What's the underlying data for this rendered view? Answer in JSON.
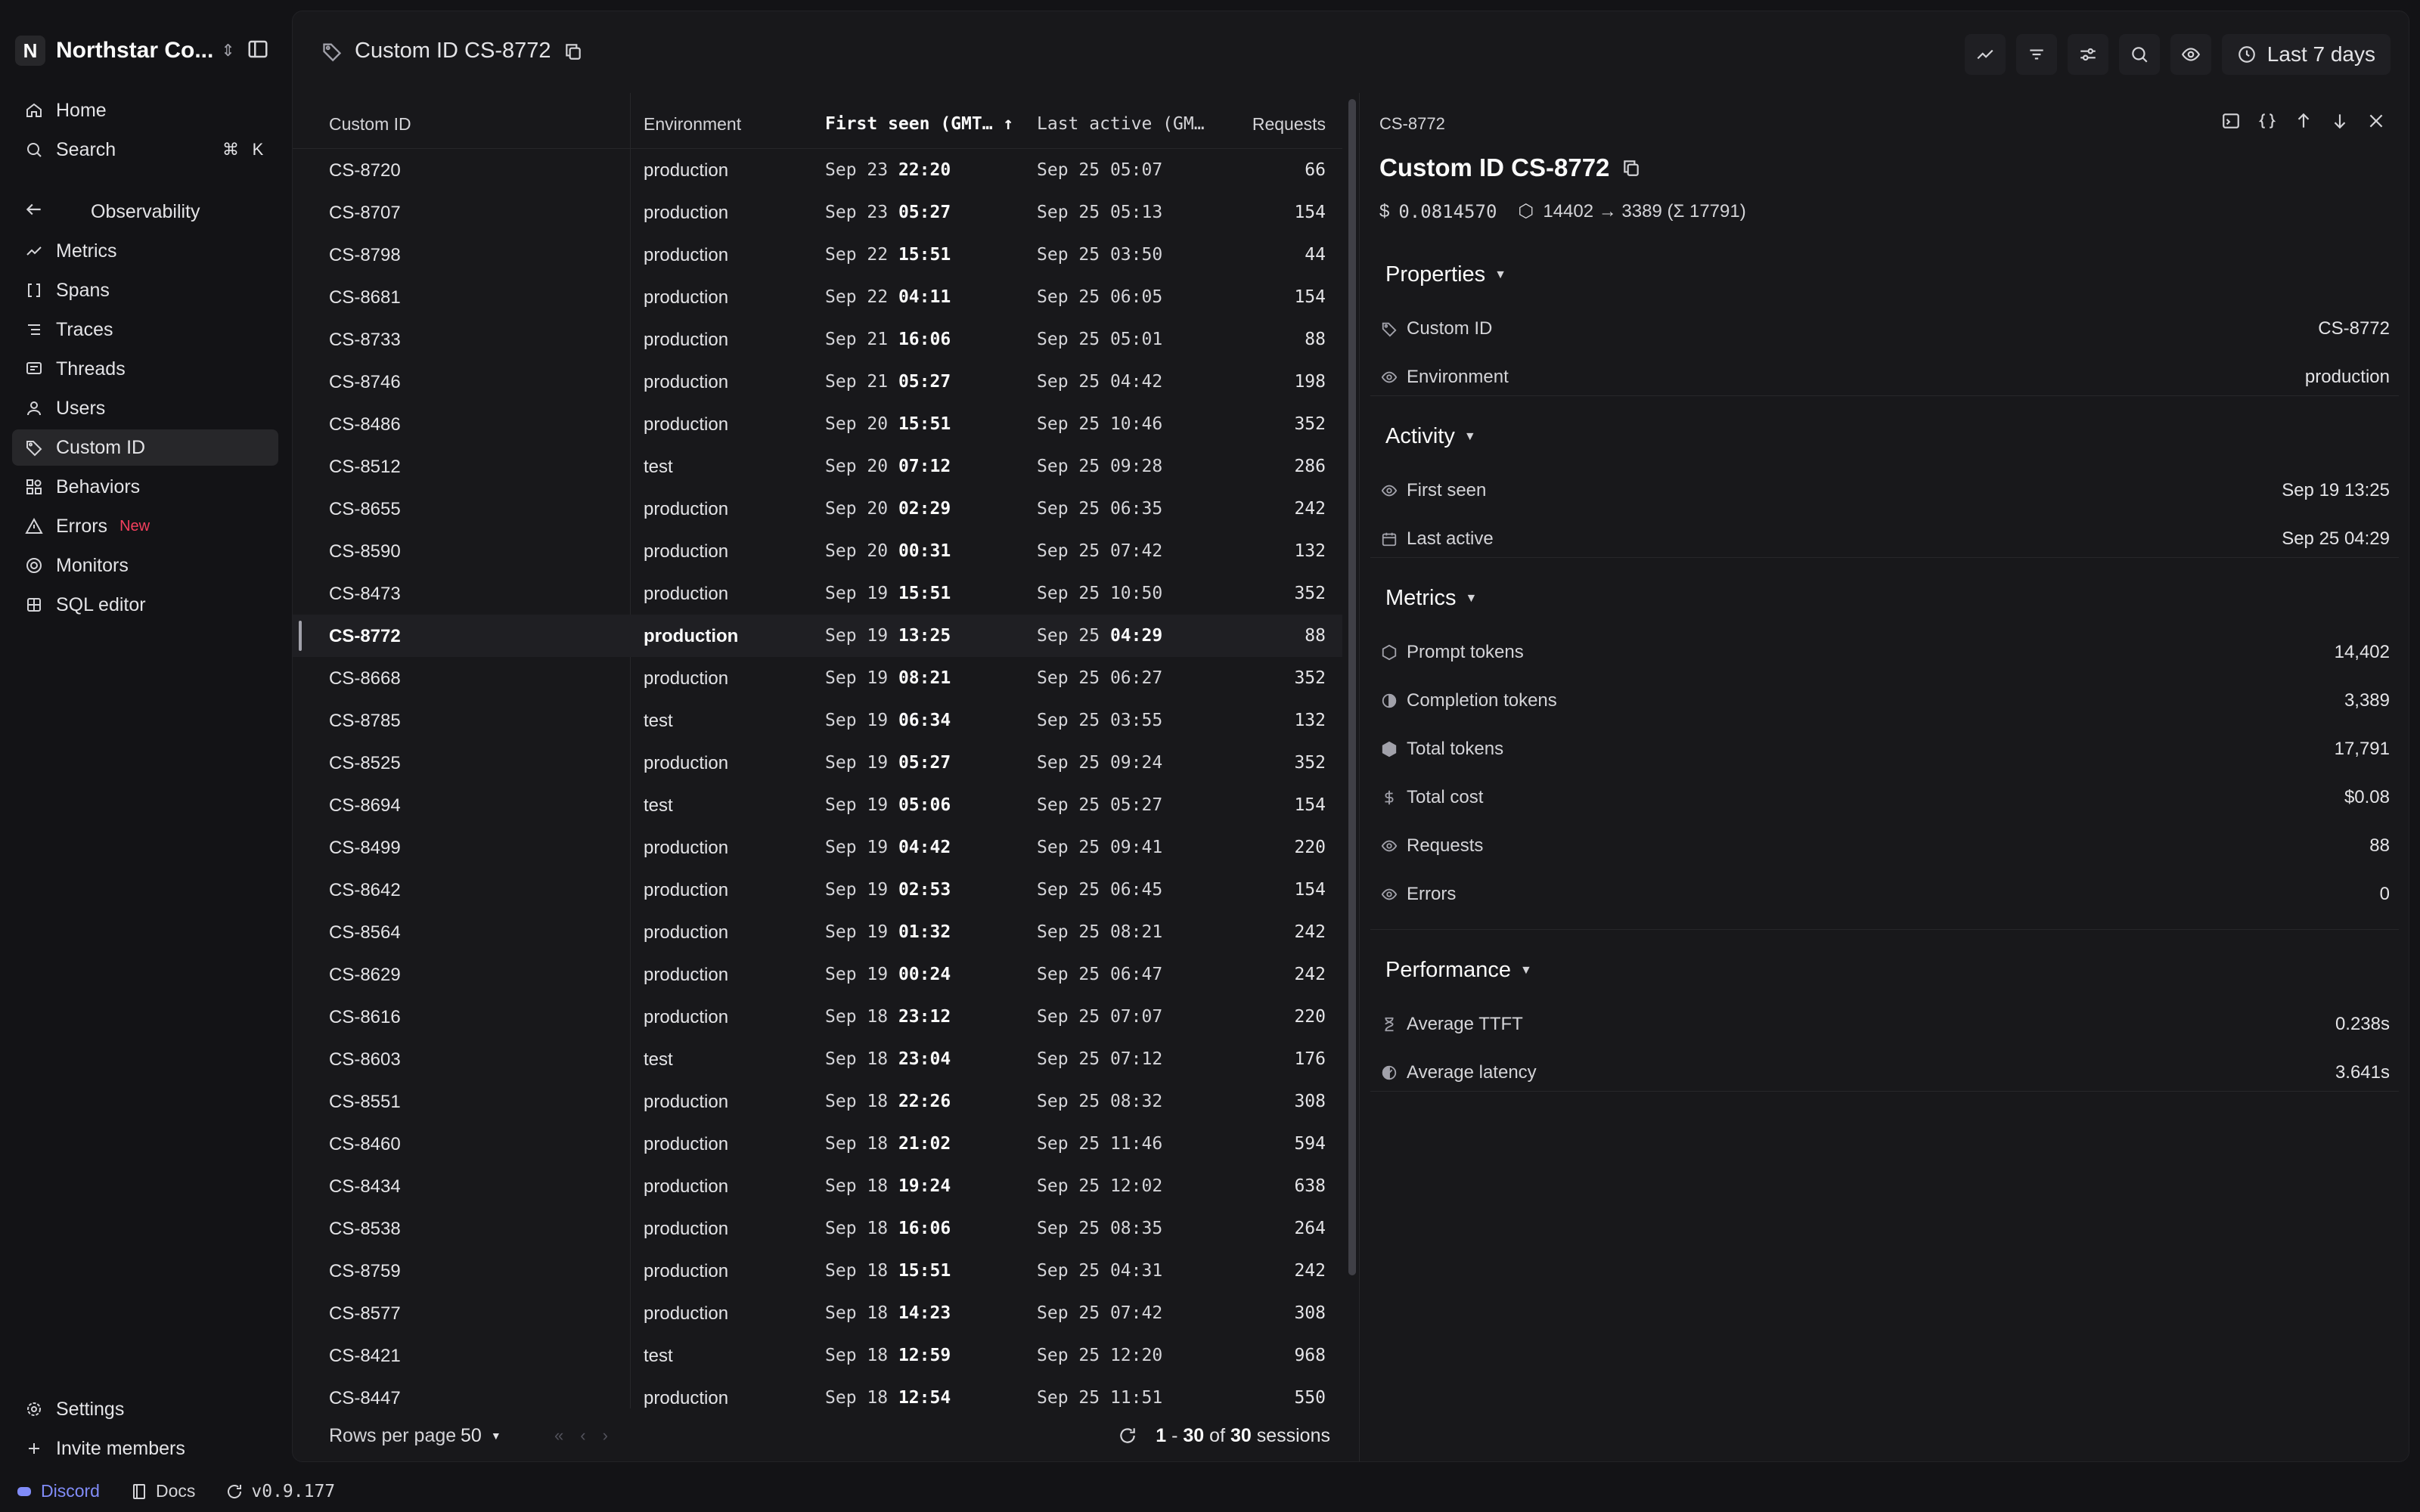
{
  "org": {
    "initial": "N",
    "name": "Northstar Co..."
  },
  "nav": {
    "home": "Home",
    "search": "Search",
    "search_kbd": [
      "⌘",
      "K"
    ],
    "section": "Observability",
    "items": [
      {
        "label": "Metrics",
        "icon": "chart-line-icon"
      },
      {
        "label": "Spans",
        "icon": "brackets-icon"
      },
      {
        "label": "Traces",
        "icon": "list-tree-icon"
      },
      {
        "label": "Threads",
        "icon": "message-icon"
      },
      {
        "label": "Users",
        "icon": "user-icon"
      },
      {
        "label": "Custom ID",
        "icon": "tag-icon",
        "active": true
      },
      {
        "label": "Behaviors",
        "icon": "shapes-icon"
      },
      {
        "label": "Errors",
        "icon": "warning-icon",
        "badge": "New"
      },
      {
        "label": "Monitors",
        "icon": "radar-icon"
      },
      {
        "label": "SQL editor",
        "icon": "database-icon"
      }
    ],
    "settings": "Settings",
    "invite": "Invite members"
  },
  "footer": {
    "discord": "Discord",
    "docs": "Docs",
    "version": "v0.9.177"
  },
  "header": {
    "title": "Custom ID CS-8772",
    "range": "Last 7 days"
  },
  "table": {
    "columns": {
      "id": "Custom ID",
      "env": "Environment",
      "first_seen": "First seen (GMT…",
      "last_active": "Last active (GM…",
      "requests": "Requests"
    },
    "rows": [
      {
        "id": "CS-8720",
        "env": "production",
        "fs_d": "Sep 23",
        "fs_t": "22:20",
        "la_d": "Sep 25",
        "la_t": "05:07",
        "req": "66"
      },
      {
        "id": "CS-8707",
        "env": "production",
        "fs_d": "Sep 23",
        "fs_t": "05:27",
        "la_d": "Sep 25",
        "la_t": "05:13",
        "req": "154"
      },
      {
        "id": "CS-8798",
        "env": "production",
        "fs_d": "Sep 22",
        "fs_t": "15:51",
        "la_d": "Sep 25",
        "la_t": "03:50",
        "req": "44"
      },
      {
        "id": "CS-8681",
        "env": "production",
        "fs_d": "Sep 22",
        "fs_t": "04:11",
        "la_d": "Sep 25",
        "la_t": "06:05",
        "req": "154"
      },
      {
        "id": "CS-8733",
        "env": "production",
        "fs_d": "Sep 21",
        "fs_t": "16:06",
        "la_d": "Sep 25",
        "la_t": "05:01",
        "req": "88"
      },
      {
        "id": "CS-8746",
        "env": "production",
        "fs_d": "Sep 21",
        "fs_t": "05:27",
        "la_d": "Sep 25",
        "la_t": "04:42",
        "req": "198"
      },
      {
        "id": "CS-8486",
        "env": "production",
        "fs_d": "Sep 20",
        "fs_t": "15:51",
        "la_d": "Sep 25",
        "la_t": "10:46",
        "req": "352"
      },
      {
        "id": "CS-8512",
        "env": "test",
        "fs_d": "Sep 20",
        "fs_t": "07:12",
        "la_d": "Sep 25",
        "la_t": "09:28",
        "req": "286"
      },
      {
        "id": "CS-8655",
        "env": "production",
        "fs_d": "Sep 20",
        "fs_t": "02:29",
        "la_d": "Sep 25",
        "la_t": "06:35",
        "req": "242"
      },
      {
        "id": "CS-8590",
        "env": "production",
        "fs_d": "Sep 20",
        "fs_t": "00:31",
        "la_d": "Sep 25",
        "la_t": "07:42",
        "req": "132"
      },
      {
        "id": "CS-8473",
        "env": "production",
        "fs_d": "Sep 19",
        "fs_t": "15:51",
        "la_d": "Sep 25",
        "la_t": "10:50",
        "req": "352"
      },
      {
        "id": "CS-8772",
        "env": "production",
        "fs_d": "Sep 19",
        "fs_t": "13:25",
        "la_d": "Sep 25",
        "la_t": "04:29",
        "req": "88",
        "selected": true
      },
      {
        "id": "CS-8668",
        "env": "production",
        "fs_d": "Sep 19",
        "fs_t": "08:21",
        "la_d": "Sep 25",
        "la_t": "06:27",
        "req": "352"
      },
      {
        "id": "CS-8785",
        "env": "test",
        "fs_d": "Sep 19",
        "fs_t": "06:34",
        "la_d": "Sep 25",
        "la_t": "03:55",
        "req": "132"
      },
      {
        "id": "CS-8525",
        "env": "production",
        "fs_d": "Sep 19",
        "fs_t": "05:27",
        "la_d": "Sep 25",
        "la_t": "09:24",
        "req": "352"
      },
      {
        "id": "CS-8694",
        "env": "test",
        "fs_d": "Sep 19",
        "fs_t": "05:06",
        "la_d": "Sep 25",
        "la_t": "05:27",
        "req": "154"
      },
      {
        "id": "CS-8499",
        "env": "production",
        "fs_d": "Sep 19",
        "fs_t": "04:42",
        "la_d": "Sep 25",
        "la_t": "09:41",
        "req": "220"
      },
      {
        "id": "CS-8642",
        "env": "production",
        "fs_d": "Sep 19",
        "fs_t": "02:53",
        "la_d": "Sep 25",
        "la_t": "06:45",
        "req": "154"
      },
      {
        "id": "CS-8564",
        "env": "production",
        "fs_d": "Sep 19",
        "fs_t": "01:32",
        "la_d": "Sep 25",
        "la_t": "08:21",
        "req": "242"
      },
      {
        "id": "CS-8629",
        "env": "production",
        "fs_d": "Sep 19",
        "fs_t": "00:24",
        "la_d": "Sep 25",
        "la_t": "06:47",
        "req": "242"
      },
      {
        "id": "CS-8616",
        "env": "production",
        "fs_d": "Sep 18",
        "fs_t": "23:12",
        "la_d": "Sep 25",
        "la_t": "07:07",
        "req": "220"
      },
      {
        "id": "CS-8603",
        "env": "test",
        "fs_d": "Sep 18",
        "fs_t": "23:04",
        "la_d": "Sep 25",
        "la_t": "07:12",
        "req": "176"
      },
      {
        "id": "CS-8551",
        "env": "production",
        "fs_d": "Sep 18",
        "fs_t": "22:26",
        "la_d": "Sep 25",
        "la_t": "08:32",
        "req": "308"
      },
      {
        "id": "CS-8460",
        "env": "production",
        "fs_d": "Sep 18",
        "fs_t": "21:02",
        "la_d": "Sep 25",
        "la_t": "11:46",
        "req": "594"
      },
      {
        "id": "CS-8434",
        "env": "production",
        "fs_d": "Sep 18",
        "fs_t": "19:24",
        "la_d": "Sep 25",
        "la_t": "12:02",
        "req": "638"
      },
      {
        "id": "CS-8538",
        "env": "production",
        "fs_d": "Sep 18",
        "fs_t": "16:06",
        "la_d": "Sep 25",
        "la_t": "08:35",
        "req": "264"
      },
      {
        "id": "CS-8759",
        "env": "production",
        "fs_d": "Sep 18",
        "fs_t": "15:51",
        "la_d": "Sep 25",
        "la_t": "04:31",
        "req": "242"
      },
      {
        "id": "CS-8577",
        "env": "production",
        "fs_d": "Sep 18",
        "fs_t": "14:23",
        "la_d": "Sep 25",
        "la_t": "07:42",
        "req": "308"
      },
      {
        "id": "CS-8421",
        "env": "test",
        "fs_d": "Sep 18",
        "fs_t": "12:59",
        "la_d": "Sep 25",
        "la_t": "12:20",
        "req": "968"
      },
      {
        "id": "CS-8447",
        "env": "production",
        "fs_d": "Sep 18",
        "fs_t": "12:54",
        "la_d": "Sep 25",
        "la_t": "11:51",
        "req": "550"
      }
    ]
  },
  "pager": {
    "rows_label": "Rows per page",
    "rows_value": "50",
    "range_a": "1",
    "range_dash": " - ",
    "range_b": "30",
    "of": " of ",
    "total": "30",
    "unit": " sessions"
  },
  "detail": {
    "id": "CS-8772",
    "title": "Custom ID CS-8772",
    "cost_meta": "0.0814570",
    "tokens_meta": "14402 → 3389 (Σ 17791)",
    "sections": {
      "properties": "Properties",
      "activity": "Activity",
      "metrics": "Metrics",
      "performance": "Performance"
    },
    "properties": [
      {
        "k": "Custom ID",
        "v": "CS-8772",
        "icon": "tag-icon"
      },
      {
        "k": "Environment",
        "v": "production",
        "icon": "eye-icon"
      }
    ],
    "activity": [
      {
        "k": "First seen",
        "v": "Sep 19 13:25",
        "icon": "eye-icon"
      },
      {
        "k": "Last active",
        "v": "Sep 25 04:29",
        "icon": "calendar-icon"
      }
    ],
    "metrics": [
      {
        "k": "Prompt tokens",
        "v": "14,402",
        "icon": "hexagon-icon"
      },
      {
        "k": "Completion tokens",
        "v": "3,389",
        "icon": "half-circle-icon"
      },
      {
        "k": "Total tokens",
        "v": "17,791",
        "icon": "filled-circle-icon"
      },
      {
        "k": "Total cost",
        "v": "$0.08",
        "icon": "dollar-icon"
      },
      {
        "k": "Requests",
        "v": "88",
        "icon": "eye-icon"
      },
      {
        "k": "Errors",
        "v": "0",
        "icon": "eye-icon"
      }
    ],
    "performance": [
      {
        "k": "Average TTFT",
        "v": "0.238s",
        "icon": "hourglass-icon"
      },
      {
        "k": "Average latency",
        "v": "3.641s",
        "icon": "gauge-icon"
      }
    ]
  }
}
